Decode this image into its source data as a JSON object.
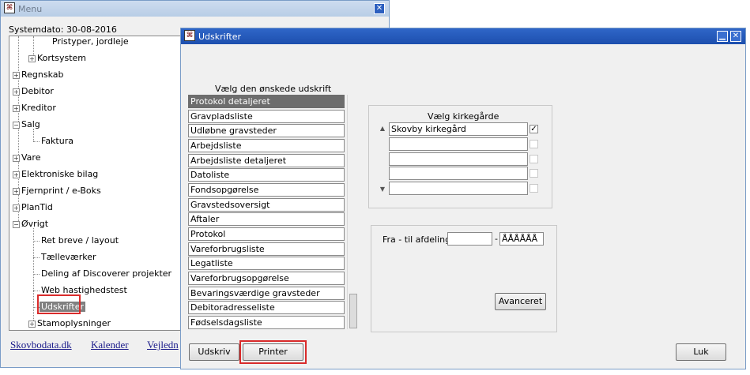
{
  "menu_window": {
    "title": "Menu",
    "systemdato": "Systemdato: 30-08-2016",
    "tree": [
      {
        "label": "Pristyper, jordleje",
        "expander": ""
      },
      {
        "label": "Kortsystem",
        "expander": "+"
      },
      {
        "label": "Regnskab",
        "expander": "+"
      },
      {
        "label": "Debitor",
        "expander": "+"
      },
      {
        "label": "Kreditor",
        "expander": "+"
      },
      {
        "label": "Salg",
        "expander": "-"
      },
      {
        "label": "Faktura",
        "expander": ""
      },
      {
        "label": "Vare",
        "expander": "+"
      },
      {
        "label": "Elektroniske bilag",
        "expander": "+"
      },
      {
        "label": "Fjernprint / e-Boks",
        "expander": "+"
      },
      {
        "label": "PlanTid",
        "expander": "+"
      },
      {
        "label": "Øvrigt",
        "expander": "-"
      },
      {
        "label": "Ret breve / layout",
        "expander": ""
      },
      {
        "label": "Tælleværker",
        "expander": ""
      },
      {
        "label": "Deling af Discoverer projekter",
        "expander": ""
      },
      {
        "label": "Web hastighedstest",
        "expander": ""
      },
      {
        "label": "Udskrifter",
        "expander": "",
        "selected": true
      },
      {
        "label": "Stamoplysninger",
        "expander": "+"
      }
    ],
    "links": [
      "Skovbodata.dk",
      "Kalender",
      "Vejledn"
    ]
  },
  "udskrifter_window": {
    "title": "Udskrifter",
    "list_heading": "Vælg den ønskede udskrift",
    "reports": [
      "Protokol detaljeret",
      "Gravpladsliste",
      "Udløbne gravsteder",
      "Arbejdsliste",
      "Arbejdsliste detaljeret",
      "Datoliste",
      "Fondsopgørelse",
      "Gravstedsoversigt",
      "Aftaler",
      "Protokol",
      "Vareforbrugsliste",
      "Legatliste",
      "Vareforbrugsopgørelse",
      "Bevaringsværdige gravsteder",
      "Debitoradresseliste",
      "Fødselsdagsliste"
    ],
    "selected_report": "Protokol detaljeret",
    "kirkegaarde_heading": "Vælg kirkegårde",
    "kirkegaarde": [
      {
        "name": "Skovby kirkegård",
        "checked": true
      },
      {
        "name": "",
        "checked": false
      },
      {
        "name": "",
        "checked": false
      },
      {
        "name": "",
        "checked": false
      },
      {
        "name": "",
        "checked": false
      }
    ],
    "afdeling_label": "Fra - til afdeling",
    "afdeling_from": "",
    "afdeling_separator": "-",
    "afdeling_to": "ÅÅÅÅÅÅ",
    "buttons": {
      "avanceret": "Avanceret",
      "udskriv": "Udskriv",
      "printer": "Printer",
      "luk": "Luk"
    }
  },
  "colors": {
    "title_active": "#1d4fae",
    "title_inactive": "#b8cde6",
    "selection": "#6d6d6d",
    "highlight_box": "#d92b2b"
  }
}
